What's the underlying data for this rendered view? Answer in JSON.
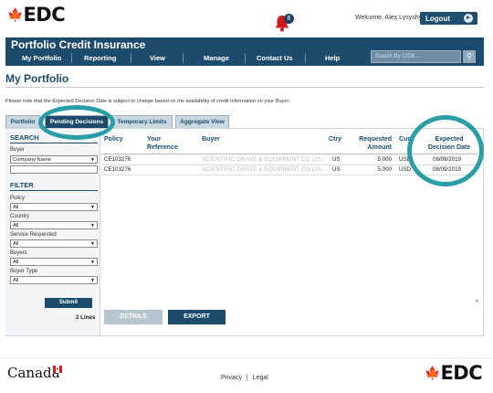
{
  "header": {
    "brand": "EDC",
    "notifications_count": "6",
    "welcome": "Welcome, Alex Lysyshyn |",
    "logout": "Logout"
  },
  "banner": {
    "title": "Portfolio Credit Insurance",
    "nav": [
      "My Portfolio",
      "Reporting",
      "View",
      "Manage",
      "Contact Us",
      "Help"
    ],
    "search_placeholder": "Search By CIDB..."
  },
  "page": {
    "title": "My Portfolio",
    "notice": "Please note that the Expected Decision Date is subject to change based on the availability of credit information on your Buyer."
  },
  "tabs": [
    "Portfolio",
    "Pending Decisions",
    "Temporary Limits",
    "Aggregate View"
  ],
  "active_tab": "Pending Decisions",
  "sidebar": {
    "search_title": "SEARCH",
    "buyer_label": "Buyer",
    "buyer_select": "Company Name",
    "filter_title": "FILTER",
    "filters": [
      {
        "label": "Policy",
        "value": "All"
      },
      {
        "label": "Country",
        "value": "All"
      },
      {
        "label": "Service Requested",
        "value": "All"
      },
      {
        "label": "Buyers",
        "value": "All"
      },
      {
        "label": "Buyer Type",
        "value": "All"
      }
    ],
    "submit": "Submit",
    "line_count": "2 Lines"
  },
  "table": {
    "columns": {
      "policy": "Policy",
      "your_reference_1": "Your",
      "your_reference_2": "Reference",
      "buyer": "Buyer",
      "ctry": "Ctry",
      "requested_1": "Requested",
      "requested_2": "Amount",
      "currency": "Cur",
      "expected_1": "Expected",
      "expected_2": "Decision Date"
    },
    "rows": [
      {
        "policy": "CE103276",
        "reference": "",
        "buyer": "SCIENTIFIC GRAVE & EQUIPMENT CO (20...",
        "ctry": "US",
        "amount": "5,000",
        "currency": "USD",
        "date": "08/09/2019"
      },
      {
        "policy": "CE103276",
        "reference": "",
        "buyer": "SCIENTIFIC GRAVE & EQUIPMENT CO (20...",
        "ctry": "US",
        "amount": "5,000",
        "currency": "USD",
        "date": "08/09/2019"
      }
    ]
  },
  "actions": {
    "details": "DETAILS",
    "export": "EXPORT"
  },
  "footer": {
    "canada": "Canada",
    "privacy": "Privacy",
    "sep": "|",
    "legal": "Legal",
    "brand": "EDC"
  },
  "colors": {
    "brand_blue": "#1d4b6b",
    "callout_teal": "#2a9ea6",
    "alert_red": "#d21a1a"
  }
}
